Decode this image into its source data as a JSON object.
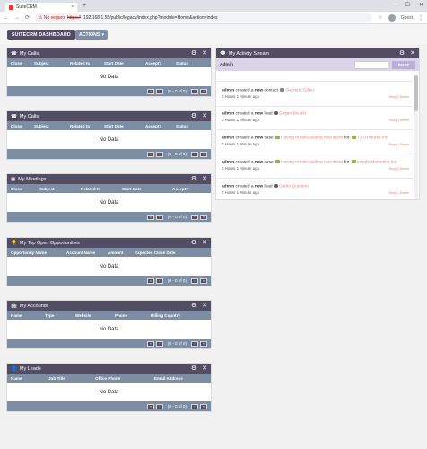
{
  "browser": {
    "tab_title": "SuiteCRM",
    "tab_close": "×",
    "new_tab": "+",
    "min": "—",
    "max": "☐",
    "close": "✕",
    "back": "←",
    "forward": "→",
    "reload": "⟳",
    "warning": "⚠ No seguro",
    "url_https": "https://",
    "url_rest": "192.168.1.55/public/legacy/index.php?module=Home&action=index",
    "star": "☆",
    "profile_label": "Guest",
    "menu": "⋮"
  },
  "toolbar": {
    "dashboard_label": "SUITECRM DASHBOARD",
    "actions_label": "ACTIONS",
    "actions_caret": "▾"
  },
  "pager": {
    "first": "«",
    "prev": "‹",
    "info": "(0 - 0 of 0)",
    "next": "›",
    "last": "»"
  },
  "no_data": "No Data",
  "dashlets": {
    "calls1": {
      "title": "My Calls",
      "icon": "☎",
      "cols": [
        "Close",
        "Subject",
        "Related to",
        "Start Date",
        "Accept?",
        "Status"
      ]
    },
    "calls2": {
      "title": "My Calls",
      "icon": "☎",
      "cols": [
        "Close",
        "Subject",
        "Related to",
        "Start Date",
        "Accept?",
        "Status"
      ]
    },
    "meetings": {
      "title": "My Meetings",
      "icon": "▦",
      "cols": [
        "Close",
        "Subject",
        "Related to",
        "Start Date",
        "Accept?"
      ]
    },
    "opportunities": {
      "title": "My Top Open Opportunities",
      "icon": "💡",
      "cols": [
        "Opportunity Name",
        "Account Name",
        "Amount",
        "Expected Close Date"
      ]
    },
    "accounts": {
      "title": "My Accounts",
      "icon": "🏢",
      "cols": [
        "Name",
        "Type",
        "Website",
        "Phone",
        "Billing Country"
      ]
    },
    "leads": {
      "title": "My Leads",
      "icon": "👤",
      "cols": [
        "Name",
        "Job Title",
        "Office Phone",
        "Email Address"
      ]
    }
  },
  "dashlet_controls": {
    "settings": "⚙",
    "close": "✕"
  },
  "stream": {
    "title": "My Activity Stream",
    "icon": "💬",
    "post_user": "Admin",
    "post_label": "POST",
    "entries": [
      {
        "user": "admin",
        "verb": "created a ",
        "new": "new",
        "kind": " contact ",
        "target": "Gabriela Gillen",
        "time": "0 Hours 1 Minute ago",
        "actions": "Reply | Delete"
      },
      {
        "user": "admin",
        "verb": "created a ",
        "new": "new",
        "kind": " lead ",
        "target": "Ginger Bicaler",
        "time": "0 Hours 1 Minute ago",
        "actions": "Reply | Delete"
      },
      {
        "user": "admin",
        "verb": "created a ",
        "new": "new",
        "kind": " case ",
        "target": "Having trouble adding new items",
        "for": " for ",
        "account": "TJ O'Rourke Inc",
        "time": "0 Hours 1 Minute ago",
        "actions": "Reply | Delete"
      },
      {
        "user": "admin",
        "verb": "created a ",
        "new": "new",
        "kind": " case ",
        "target": "Having trouble adding new items",
        "for": " for ",
        "account": "Insight Marketing Inc",
        "time": "0 Hours 1 Minute ago",
        "actions": "Reply | Delete"
      },
      {
        "user": "admin",
        "verb": "created a ",
        "new": "new",
        "kind": " lead ",
        "target": "Carter Quintero",
        "time": "0 Hours 1 Minute ago",
        "actions": "Reply | Delete"
      }
    ]
  }
}
